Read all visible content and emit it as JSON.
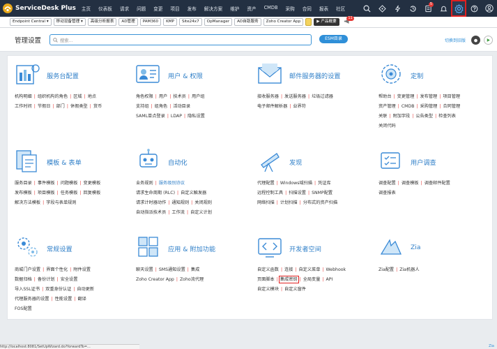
{
  "app": {
    "name": "ServiceDesk Plus"
  },
  "nav": [
    "主页",
    "仪表板",
    "请求",
    "问题",
    "变更",
    "项目",
    "发布",
    "解决方案",
    "维护",
    "资产",
    "CMDB",
    "采购",
    "合同",
    "报表",
    "社区"
  ],
  "top_icons": {
    "notification_count": "5"
  },
  "products": {
    "items": [
      "Endpoint Central ▾",
      "移动设备管理 ▾",
      "高级分析报表",
      "AD管理",
      "PAM360",
      "KMP",
      "Site24x7",
      "OpManager",
      "AD自助服务",
      "Zoho Creator App"
    ],
    "features_label": "▶ 产品概要",
    "features_badge": "11"
  },
  "header": {
    "title": "管理设置",
    "search_placeholder": "搜索...",
    "esm_label": "ESM目录",
    "classic_label": "切换到旧版"
  },
  "cards": [
    {
      "title": "服务台配置",
      "icon": "helpdesk-config-icon",
      "rows": [
        [
          "机构明细",
          "组织机构的角色",
          "区域",
          "地点"
        ],
        [
          "工作时间",
          "节假日",
          "部门",
          "休假类型",
          "货币"
        ]
      ]
    },
    {
      "title": "用户 & 权限",
      "icon": "users-permissions-icon",
      "rows": [
        [
          "角色权限",
          "用户",
          "技术员",
          "用户组"
        ],
        [
          "支持组",
          "组角色",
          "活动目录"
        ],
        [
          "SAML单点登录",
          "LDAP",
          "隐私设置"
        ]
      ]
    },
    {
      "title": "邮件服务器的设置",
      "icon": "mail-server-icon",
      "rows": [
        [
          "接收服务器",
          "发送服务器",
          "垃圾过滤器"
        ],
        [
          "电子邮件解析器",
          "业界符"
        ]
      ]
    },
    {
      "title": "定制",
      "icon": "customization-icon",
      "rows": [
        [
          "帮助台",
          "变更管理",
          "发布管理",
          "项目管理"
        ],
        [
          "资产管理",
          "CMDB",
          "采购管理",
          "合同管理"
        ],
        [
          "关联",
          "附加字段",
          "公告类型",
          "检查列表"
        ],
        [
          "关闭代码"
        ]
      ]
    },
    {
      "title": "模板 & 表单",
      "icon": "templates-forms-icon",
      "rows": [
        [
          "服务目录",
          "事件模板",
          "问题模板",
          "变更模板"
        ],
        [
          "发布模板",
          "项目模板",
          "任务模板",
          "回复模板"
        ],
        [
          "解决方法模板",
          "字段与表单规则"
        ]
      ]
    },
    {
      "title": "自动化",
      "icon": "automation-icon",
      "rows": [
        [
          "业务规则",
          "服务级别协议"
        ],
        [
          "请求生命周期 (RLC)",
          "自定义触发器"
        ],
        [
          "请求计时器动作",
          "通知规则",
          "关闭规则"
        ],
        [
          "自动指派技术员",
          "工作流",
          "自定义计划"
        ]
      ]
    },
    {
      "title": "发现",
      "icon": "discovery-icon",
      "rows": [
        [
          "代理配置",
          "Windows域扫描",
          "凭证库"
        ],
        [
          "远程控制工具",
          "扫描设置",
          "SNMP配置"
        ],
        [
          "网络扫描",
          "计划扫描",
          "分布式的资产扫描"
        ]
      ]
    },
    {
      "title": "用户调查",
      "icon": "survey-icon",
      "rows": [
        [
          "调查配置",
          "调查模板",
          "调查邮件配置"
        ],
        [
          "调查报表"
        ]
      ]
    },
    {
      "title": "常规设置",
      "icon": "general-settings-icon",
      "rows": [
        [
          "商城门户设置",
          "界面个性化",
          "附件设置"
        ],
        [
          "数据归档",
          "备份计划",
          "安全设置"
        ],
        [
          "导入SSL证书",
          "双重身份认证",
          "自动更新"
        ],
        [
          "代理服务器的设置",
          "性能设置",
          "翻译"
        ],
        [
          "FOS配置"
        ]
      ]
    },
    {
      "title": "应用 & 附加功能",
      "icon": "apps-addons-icon",
      "rows": [
        [
          "聊天设置",
          "SMS通知设置",
          "集成"
        ],
        [
          "Zoho Creator App",
          "Zoho流代理"
        ]
      ]
    },
    {
      "title": "开发者空间",
      "icon": "developer-space-icon",
      "rows": [
        [
          "自定义函数",
          "连接",
          "自定义菜单",
          "Webhook"
        ],
        [
          "页面脚本",
          "集成密钥",
          "全局变量",
          "API"
        ],
        [
          "自定义模块",
          "自定义窗件"
        ]
      ]
    },
    {
      "title": "Zia",
      "icon": "zia-icon",
      "rows": [
        [
          "Zia配置",
          "Zia机器人"
        ]
      ]
    }
  ],
  "status_url": "http://localhost:8081/SetUpWizard.do?forwardTo=...",
  "zia_corner": "Zia"
}
